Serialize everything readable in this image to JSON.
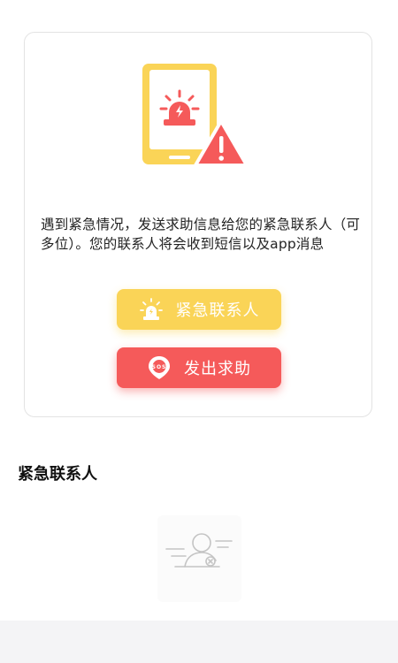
{
  "card": {
    "description": "遇到紧急情况，发送求助信息给您的紧急联系人（可多位）。您的联系人将会收到短信以及app消息",
    "contacts_button_label": "紧急联系人",
    "sos_button_label": "发出求助",
    "sos_badge_text": "SOS"
  },
  "section": {
    "title": "紧急联系人"
  },
  "colors": {
    "accent_yellow": "#fad457",
    "accent_red": "#f55a5a",
    "card_border": "#e3e3e3"
  },
  "icons": {
    "illustration": "phone-alarm-warning-illustration",
    "contacts_button": "siren-icon",
    "sos_button": "sos-location-pin-icon",
    "empty_state": "no-contact-icon"
  }
}
